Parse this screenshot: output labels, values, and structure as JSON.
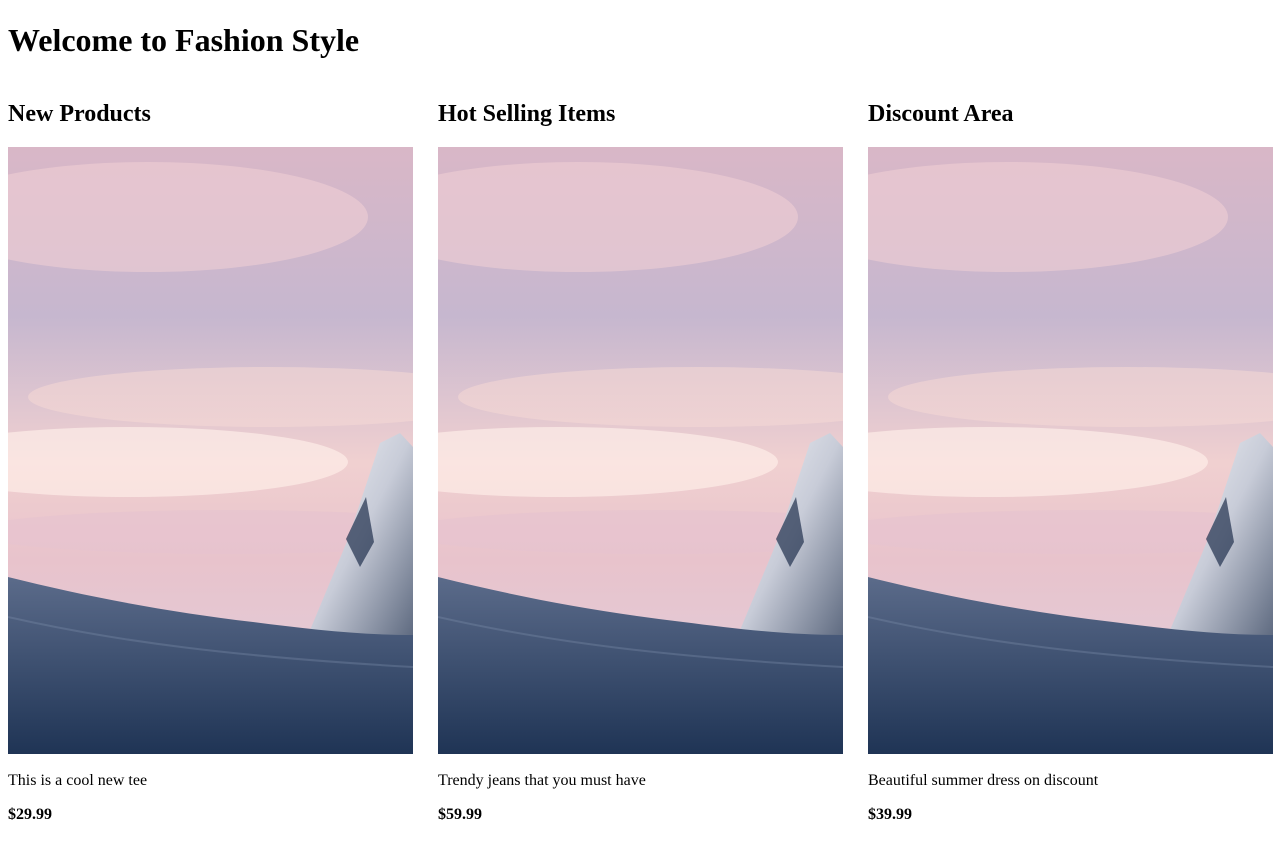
{
  "page": {
    "title": "Welcome to Fashion Style"
  },
  "sections": [
    {
      "title": "New Products",
      "description": "This is a cool new tee",
      "price": "$29.99"
    },
    {
      "title": "Hot Selling Items",
      "description": "Trendy jeans that you must have",
      "price": "$59.99"
    },
    {
      "title": "Discount Area",
      "description": "Beautiful summer dress on discount",
      "price": "$39.99"
    }
  ],
  "colors": {
    "text": "#000000",
    "background": "#ffffff"
  }
}
